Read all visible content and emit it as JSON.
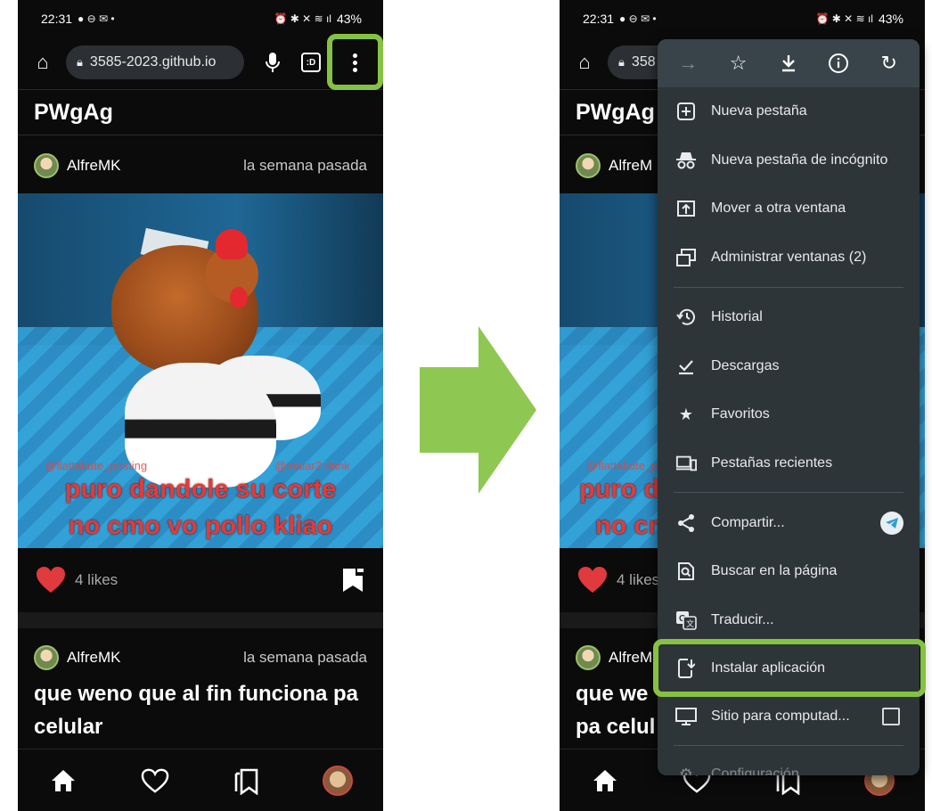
{
  "status_bar": {
    "time": "22:31",
    "battery": "43%"
  },
  "browser": {
    "url": "3585-2023.github.io",
    "url_partial": "358"
  },
  "app": {
    "title": "PWgAg"
  },
  "posts": [
    {
      "author": "AlfreMK",
      "time": "la semana pasada",
      "caption_line1": "puro dandole su corte",
      "caption_line2": "no cmo vo pollo kliao",
      "watermark_left": "@flattakute_posting",
      "watermark_right": "@malar2.dank",
      "likes": "4 likes"
    },
    {
      "author": "AlfreMK",
      "time": "la semana pasada",
      "title": "que weno que al fin funciona pa celular"
    }
  ],
  "right_panel": {
    "app_title": "PWgAg",
    "author_partial": "AlfreM",
    "likes_partial": "4 likes",
    "title_partial_line1": "que we",
    "title_partial_line2": "pa celul"
  },
  "menu": {
    "items": [
      {
        "label": "Nueva pestaña",
        "icon": "new-tab-icon"
      },
      {
        "label": "Nueva pestaña de incógnito",
        "icon": "incognito-icon"
      },
      {
        "label": "Mover a otra ventana",
        "icon": "move-window-icon"
      },
      {
        "label": "Administrar ventanas (2)",
        "icon": "windows-icon"
      },
      {
        "label": "Historial",
        "icon": "history-icon"
      },
      {
        "label": "Descargas",
        "icon": "downloads-icon"
      },
      {
        "label": "Favoritos",
        "icon": "star-icon"
      },
      {
        "label": "Pestañas recientes",
        "icon": "devices-icon"
      },
      {
        "label": "Compartir...",
        "icon": "share-icon"
      },
      {
        "label": "Buscar en la página",
        "icon": "find-icon"
      },
      {
        "label": "Traducir...",
        "icon": "translate-icon"
      },
      {
        "label": "Instalar aplicación",
        "icon": "install-app-icon"
      },
      {
        "label": "Sitio para computad...",
        "icon": "desktop-icon"
      },
      {
        "label": "Configuración",
        "icon": "settings-icon"
      }
    ]
  },
  "colors": {
    "highlight": "#86c242",
    "menu_bg": "#2e3538",
    "like": "#e0393e"
  }
}
